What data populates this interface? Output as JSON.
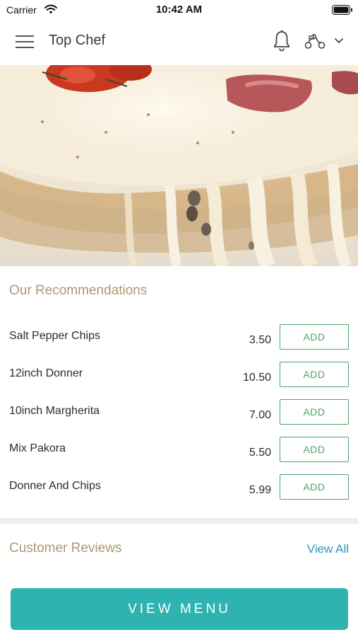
{
  "status_bar": {
    "carrier": "Carrier",
    "time": "10:42 AM"
  },
  "header": {
    "title": "Top Chef"
  },
  "recommendations": {
    "title": "Our Recommendations",
    "items": [
      {
        "name": "Salt Pepper Chips",
        "price": "3.50",
        "button": "ADD"
      },
      {
        "name": "12inch Donner",
        "price": "10.50",
        "button": "ADD"
      },
      {
        "name": "10inch Margherita",
        "price": "7.00",
        "button": "ADD"
      },
      {
        "name": "Mix Pakora",
        "price": "5.50",
        "button": "ADD"
      },
      {
        "name": "Donner And Chips",
        "price": "5.99",
        "button": "ADD"
      }
    ]
  },
  "reviews": {
    "title": "Customer Reviews",
    "view_all": "View All"
  },
  "footer": {
    "view_menu": "VIEW MENU"
  },
  "colors": {
    "accent_teal": "#2fb3b0",
    "add_green": "#4aa26a",
    "section_gold": "#a99a72",
    "link_blue": "#2a95b8"
  },
  "icons": [
    "wifi-icon",
    "battery-icon",
    "menu-icon",
    "bell-icon",
    "scooter-icon",
    "chevron-down-icon"
  ]
}
